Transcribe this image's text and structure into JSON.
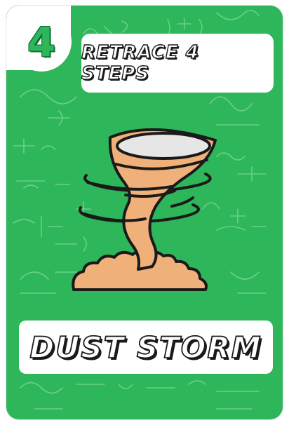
{
  "card": {
    "number": "4",
    "instruction": "RETRACE 4 STEPS",
    "title": "DUST STORM"
  },
  "colors": {
    "card_green": "#2eb65a",
    "doodle_line": "#7fd89b",
    "tornado_fill": "#f0b07a",
    "tornado_outline": "#1a1a1a",
    "panel_white": "#ffffff"
  },
  "icons": {
    "illustration": "tornado-icon",
    "background": "math-formulas-doodles"
  }
}
